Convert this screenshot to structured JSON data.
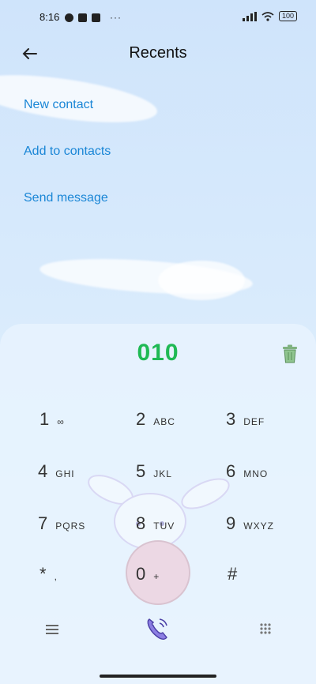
{
  "status_bar": {
    "time": "8:16",
    "more": "···",
    "battery": "100"
  },
  "header": {
    "title": "Recents"
  },
  "actions": {
    "new_contact": "New contact",
    "add_to_contacts": "Add to contacts",
    "send_message": "Send message"
  },
  "dialer": {
    "number": "010",
    "keys": [
      {
        "digit": "1",
        "letters": "∞"
      },
      {
        "digit": "2",
        "letters": "ABC"
      },
      {
        "digit": "3",
        "letters": "DEF"
      },
      {
        "digit": "4",
        "letters": "GHI"
      },
      {
        "digit": "5",
        "letters": "JKL"
      },
      {
        "digit": "6",
        "letters": "MNO"
      },
      {
        "digit": "7",
        "letters": "PQRS"
      },
      {
        "digit": "8",
        "letters": "TUV"
      },
      {
        "digit": "9",
        "letters": "WXYZ"
      },
      {
        "digit": "*",
        "letters": ","
      },
      {
        "digit": "0",
        "letters": "+"
      },
      {
        "digit": "#",
        "letters": ""
      }
    ]
  },
  "colors": {
    "accent_blue": "#1a86d6",
    "number_green": "#1fb954",
    "call_purple": "#7c6fd8"
  },
  "icons": {
    "back": "arrow-left-icon",
    "trash": "trash-icon",
    "menu": "menu-icon",
    "call": "call-icon",
    "dialpad": "dialpad-icon"
  }
}
